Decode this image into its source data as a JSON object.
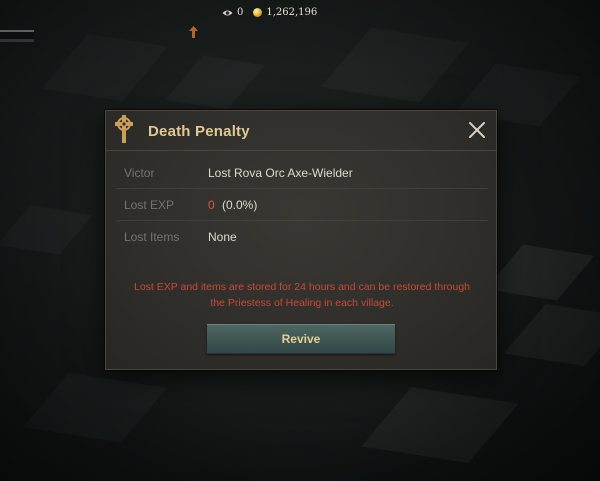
{
  "hud": {
    "watchers": "0",
    "gold": "1,262,196",
    "icons": [
      "eye-icon",
      "coin-icon",
      "marker-icon"
    ]
  },
  "dialog": {
    "title": "Death Penalty",
    "rows": [
      {
        "label": "Victor",
        "value": "Lost Rova Orc Axe-Wielder"
      },
      {
        "label": "Lost EXP",
        "value": "0",
        "extra": "(0.0%)"
      },
      {
        "label": "Lost Items",
        "value": "None"
      }
    ],
    "notice": "Lost EXP and items are stored for 24 hours and can be restored through the Priestess of Healing in each village.",
    "revive_label": "Revive"
  },
  "colors": {
    "title": "#e1c995",
    "notice": "#c74a38",
    "exp_value": "#d9573f",
    "button": "#3c5350",
    "button_text": "#e4cf99"
  }
}
